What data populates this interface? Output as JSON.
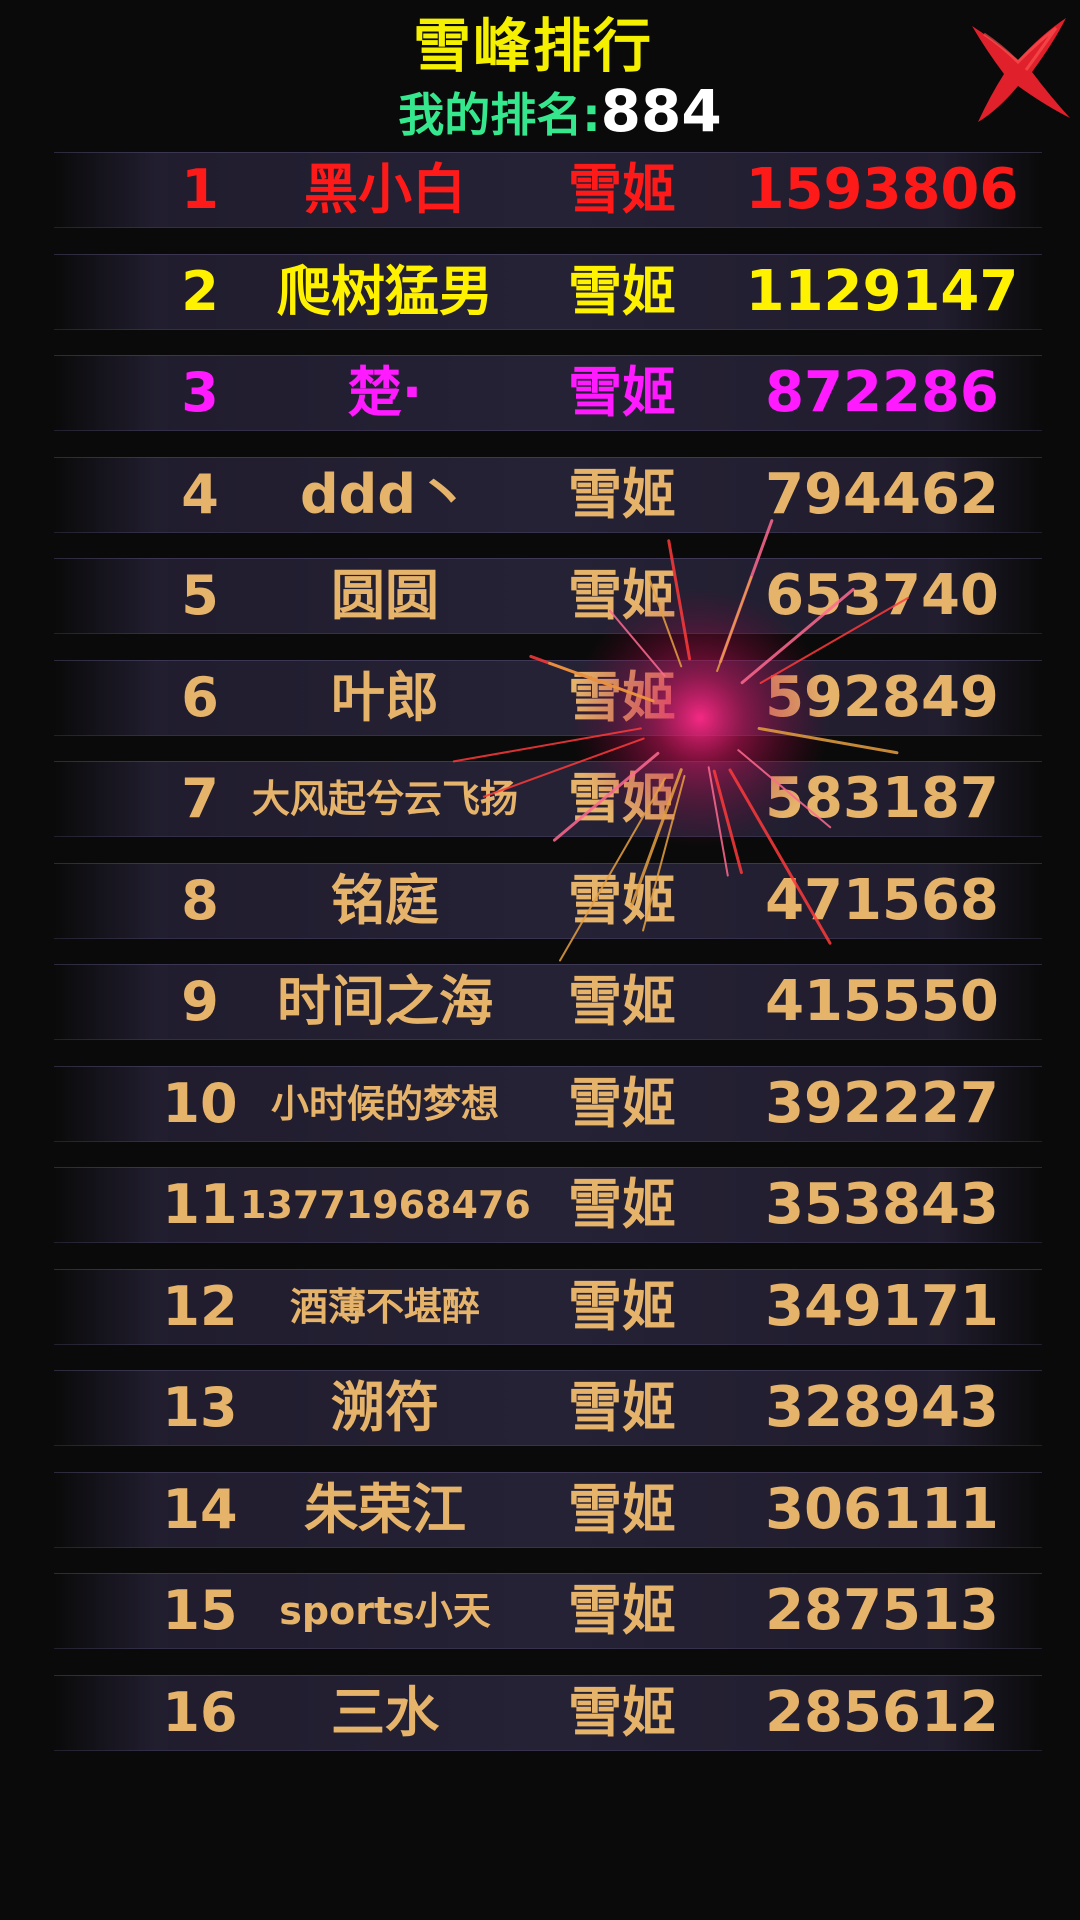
{
  "header": {
    "title": "雪峰排行",
    "my_rank_label": "我的排名:",
    "my_rank_value": "884"
  },
  "icons": {
    "close": "close-icon"
  },
  "colors": {
    "rank1": "#ff1a1a",
    "rank2": "#fff200",
    "rank3": "#ff1aff",
    "default": "#e6b36b",
    "title": "#f5f000",
    "my_rank_label": "#35e88d",
    "close": "#e8202a"
  },
  "leaderboard": {
    "rows": [
      {
        "rank": "1",
        "name": "黑小白",
        "class": "雪姬",
        "score": "1593806"
      },
      {
        "rank": "2",
        "name": "爬树猛男",
        "class": "雪姬",
        "score": "1129147"
      },
      {
        "rank": "3",
        "name": "楚·",
        "class": "雪姬",
        "score": "872286"
      },
      {
        "rank": "4",
        "name": "ddd丶",
        "class": "雪姬",
        "score": "794462"
      },
      {
        "rank": "5",
        "name": "圆圆",
        "class": "雪姬",
        "score": "653740"
      },
      {
        "rank": "6",
        "name": "叶郎",
        "class": "雪姬",
        "score": "592849"
      },
      {
        "rank": "7",
        "name": "大风起兮云飞扬",
        "class": "雪姬",
        "score": "583187"
      },
      {
        "rank": "8",
        "name": "铭庭",
        "class": "雪姬",
        "score": "471568"
      },
      {
        "rank": "9",
        "name": "时间之海",
        "class": "雪姬",
        "score": "415550"
      },
      {
        "rank": "10",
        "name": "小时候的梦想",
        "class": "雪姬",
        "score": "392227"
      },
      {
        "rank": "11",
        "name": "13771968476",
        "class": "雪姬",
        "score": "353843"
      },
      {
        "rank": "12",
        "name": "酒薄不堪醉",
        "class": "雪姬",
        "score": "349171"
      },
      {
        "rank": "13",
        "name": "溯符",
        "class": "雪姬",
        "score": "328943"
      },
      {
        "rank": "14",
        "name": "朱荣江",
        "class": "雪姬",
        "score": "306111"
      },
      {
        "rank": "15",
        "name": "sports小天",
        "class": "雪姬",
        "score": "287513"
      },
      {
        "rank": "16",
        "name": "三水",
        "class": "雪姬",
        "score": "285612"
      }
    ]
  }
}
